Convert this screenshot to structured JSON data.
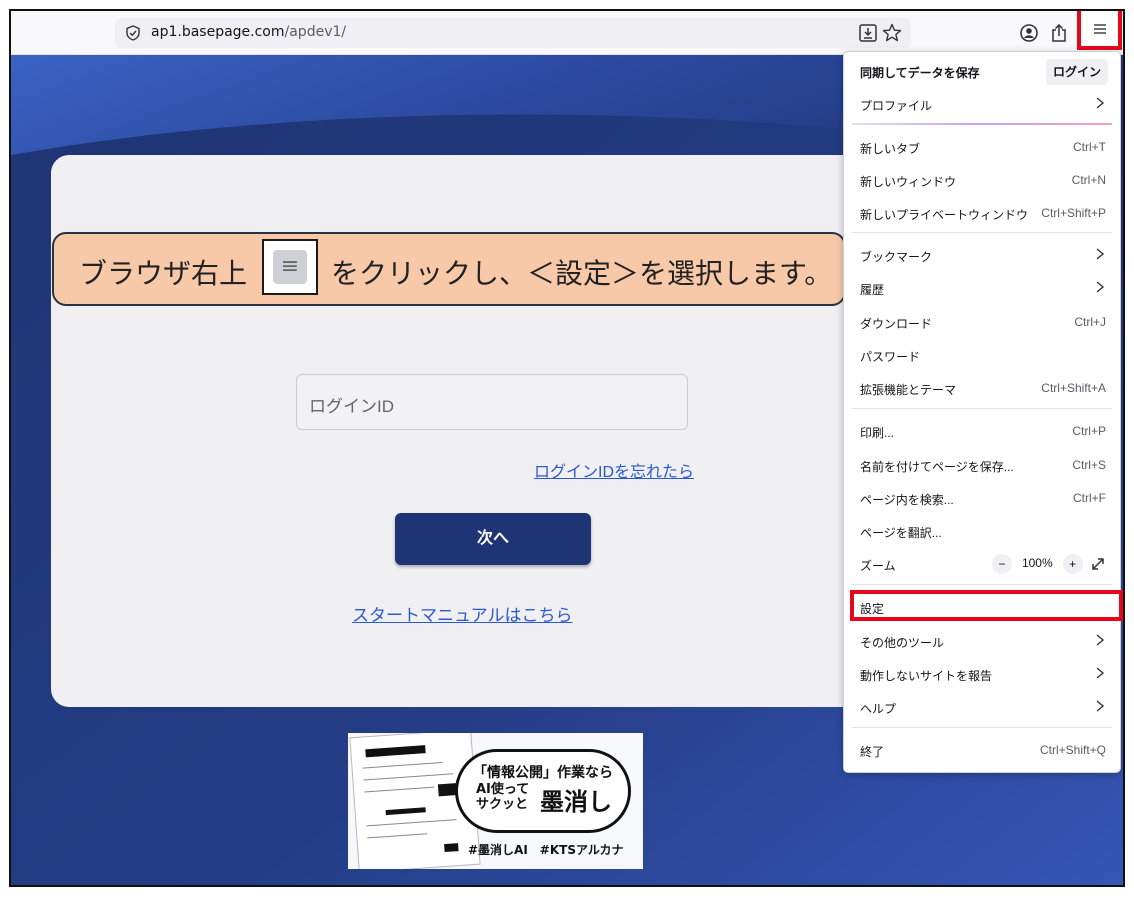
{
  "browser": {
    "url_domain": "ap1.basepage.com",
    "url_path": "/apdev1/"
  },
  "login_page": {
    "login_id_placeholder": "ログインID",
    "forgot_link": "ログインIDを忘れたら",
    "next_button": "次へ",
    "manual_link": "スタートマニュアルはこちら"
  },
  "callout": {
    "text_before": "ブラウザ右上",
    "icon_glyph": "≡",
    "text_after": "をクリックし、＜設定＞を選択します。"
  },
  "banner": {
    "line1": "「情報公開」作業なら",
    "line2a": "AI使って",
    "line2b": "サクッと",
    "big": "墨消し",
    "tags": "#墨消しAI　#KTSアルカナ"
  },
  "menu": {
    "sync_label": "同期してデータを保存",
    "login_button": "ログイン",
    "profile": "プロファイル",
    "items": [
      {
        "label": "新しいタブ",
        "shortcut": "Ctrl+T"
      },
      {
        "label": "新しいウィンドウ",
        "shortcut": "Ctrl+N"
      },
      {
        "label": "新しいプライベートウィンドウ",
        "shortcut": "Ctrl+Shift+P"
      },
      {
        "label": "ブックマーク",
        "shortcut": ""
      },
      {
        "label": "履歴",
        "shortcut": ""
      },
      {
        "label": "ダウンロード",
        "shortcut": "Ctrl+J"
      },
      {
        "label": "パスワード",
        "shortcut": ""
      },
      {
        "label": "拡張機能とテーマ",
        "shortcut": "Ctrl+Shift+A"
      },
      {
        "label": "印刷...",
        "shortcut": "Ctrl+P"
      },
      {
        "label": "名前を付けてページを保存...",
        "shortcut": "Ctrl+S"
      },
      {
        "label": "ページ内を検索...",
        "shortcut": "Ctrl+F"
      },
      {
        "label": "ページを翻訳...",
        "shortcut": ""
      },
      {
        "label": "ズーム",
        "shortcut": ""
      },
      {
        "label": "設定",
        "shortcut": ""
      },
      {
        "label": "その他のツール",
        "shortcut": ""
      },
      {
        "label": "動作しないサイトを報告",
        "shortcut": ""
      },
      {
        "label": "ヘルプ",
        "shortcut": ""
      },
      {
        "label": "終了",
        "shortcut": "Ctrl+Shift+Q"
      }
    ],
    "zoom_minus": "−",
    "zoom_level": "100%",
    "zoom_plus": "+"
  },
  "colors": {
    "highlight_red": "#e8071a",
    "navy_button": "#1f3474",
    "link_blue": "#2b59d1",
    "callout_fill": "#f7c9a8"
  }
}
